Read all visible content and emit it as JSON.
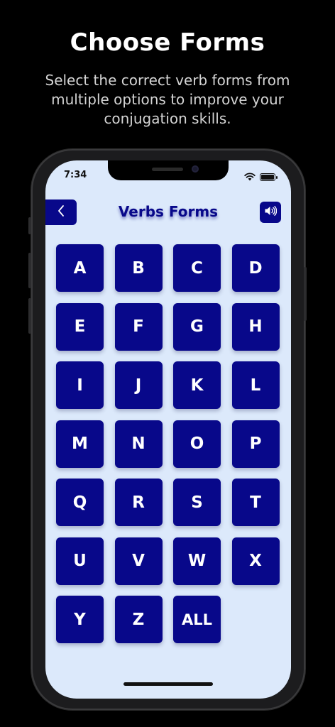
{
  "headline": "Choose Forms",
  "subline": "Select the correct verb forms from multiple options to improve your conjugation skills.",
  "status": {
    "time": "7:34"
  },
  "app": {
    "title": "Verbs Forms",
    "accent_color": "#08088a",
    "background_color": "#dce9fb"
  },
  "icons": {
    "back": "chevron-left-icon",
    "sound": "speaker-icon",
    "wifi": "wifi-icon",
    "battery": "battery-icon"
  },
  "letters": [
    "A",
    "B",
    "C",
    "D",
    "E",
    "F",
    "G",
    "H",
    "I",
    "J",
    "K",
    "L",
    "M",
    "N",
    "O",
    "P",
    "Q",
    "R",
    "S",
    "T",
    "U",
    "V",
    "W",
    "X",
    "Y",
    "Z",
    "ALL"
  ]
}
